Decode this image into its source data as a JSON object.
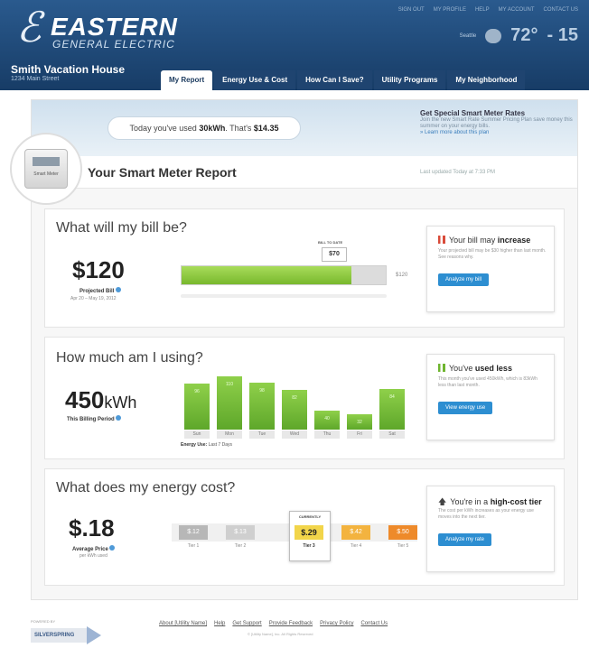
{
  "brand": {
    "name": "EASTERN",
    "sub": "GENERAL ELECTRIC"
  },
  "topnav": [
    "SIGN OUT",
    "MY PROFILE",
    "HELP",
    "MY ACCOUNT",
    "CONTACT US"
  ],
  "weather": {
    "city": "Seattle",
    "temp": "72°",
    "temp2": "- 15"
  },
  "account": {
    "name": "Smith Vacation House",
    "address": "1234 Main Street"
  },
  "tabs": [
    "My Report",
    "Energy Use & Cost",
    "How Can I Save?",
    "Utility Programs",
    "My Neighborhood"
  ],
  "banner": {
    "speech_prefix": "Today you've used ",
    "speech_kwh": "30kWh",
    "speech_mid": ". That's ",
    "speech_cost": "$14.35",
    "special_title": "Get Special Smart Meter Rates",
    "special_desc": "Join the new Smart Rate Summer Pricing Plan save money this summer on your energy bills.",
    "special_link": "» Learn more about this plan"
  },
  "report": {
    "title": "Your Smart Meter Report",
    "meter_label": "Smart Meter",
    "updated": "Last updated Today at 7:33 PM"
  },
  "bill": {
    "heading": "What will my bill be?",
    "amount": "$120",
    "label": "Projected Bill",
    "dates": "Apr 20 – May 19, 2012",
    "to_date_label": "BILL TO DATE",
    "to_date": "$70",
    "end_value": "$120",
    "progress_fraction": 0.83,
    "side_title_prefix": "Your bill may ",
    "side_title_bold": "increase",
    "side_desc": "Your projected bill may be $30 higher than last month. See reasons why.",
    "side_button": "Analyze my bill"
  },
  "usage": {
    "heading": "How much am I using?",
    "amount": "450",
    "unit": "kWh",
    "label": "This Billing Period",
    "caption_bold": "Energy Use:",
    "caption": " Last 7 Days",
    "side_title_prefix": "You've ",
    "side_title_bold": "used less",
    "side_desc": "This month you've used 450kWh, which is 83kWh less than last month.",
    "side_button": "View energy use"
  },
  "cost": {
    "heading": "What does my energy cost?",
    "amount": "$.18",
    "label": "Average Price",
    "sublabel": "per kWh used",
    "current_label": "CURRENTLY",
    "side_title_prefix": "You're in a ",
    "side_title_bold": "high-cost tier",
    "side_desc": "The cost per kWh increases as your energy use moves into the next tier.",
    "side_button": "Analyze my rate"
  },
  "chart_data": [
    {
      "type": "bar",
      "categories": [
        "Sun",
        "Mon",
        "Tue",
        "Wed",
        "Thu",
        "Fri",
        "Sat"
      ],
      "values": [
        96,
        110,
        98,
        82,
        40,
        32,
        84
      ],
      "ylim": [
        0,
        120
      ],
      "title": "",
      "xlabel": "",
      "ylabel": ""
    },
    {
      "type": "bar",
      "categories": [
        "Tier 1",
        "Tier 2",
        "Tier 3",
        "Tier 4",
        "Tier 5"
      ],
      "values": [
        0.12,
        0.13,
        0.29,
        0.42,
        0.5
      ],
      "value_labels": [
        "$.12",
        "$.13",
        "$.29",
        "$.42",
        "$.50"
      ],
      "current": "Tier 3",
      "colors": [
        "#b7b7b7",
        "#cfcfcf",
        "#f2d54a",
        "#f3b33f",
        "#ee8a2a"
      ],
      "title": "",
      "xlabel": "",
      "ylabel": ""
    }
  ],
  "footer": {
    "powered_by": "POWERED BY",
    "powered_name": "SILVERSPRING",
    "links": [
      "About [Utility Name]",
      "Help",
      "Get Support",
      "Provide Feedback",
      "Privacy Policy",
      "Contact Us"
    ],
    "copyright": "© [Utility Name], Inc. All Rights Reserved"
  }
}
